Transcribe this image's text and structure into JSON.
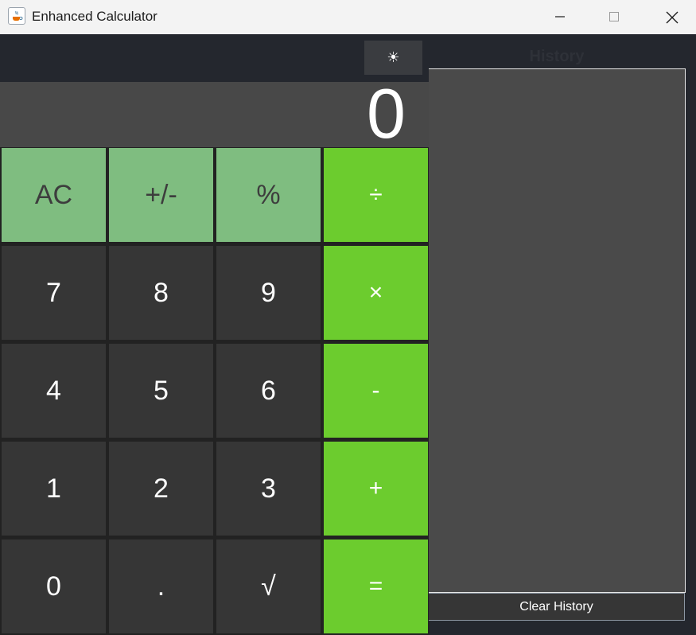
{
  "window": {
    "title": "Enhanced Calculator",
    "app_icon": "java-cup-icon",
    "controls": {
      "minimize": "minimize-icon",
      "maximize": "maximize-icon",
      "close": "close-icon"
    }
  },
  "toolbar": {
    "theme_toggle": "☀",
    "theme_icon": "sun-icon"
  },
  "display": {
    "value": "0"
  },
  "keypad": {
    "rows": [
      [
        {
          "label": "AC",
          "kind": "fn"
        },
        {
          "label": "+/-",
          "kind": "fn"
        },
        {
          "label": "%",
          "kind": "fn"
        },
        {
          "label": "÷",
          "kind": "op"
        }
      ],
      [
        {
          "label": "7",
          "kind": "num"
        },
        {
          "label": "8",
          "kind": "num"
        },
        {
          "label": "9",
          "kind": "num"
        },
        {
          "label": "×",
          "kind": "op"
        }
      ],
      [
        {
          "label": "4",
          "kind": "num"
        },
        {
          "label": "5",
          "kind": "num"
        },
        {
          "label": "6",
          "kind": "num"
        },
        {
          "label": "-",
          "kind": "op"
        }
      ],
      [
        {
          "label": "1",
          "kind": "num"
        },
        {
          "label": "2",
          "kind": "num"
        },
        {
          "label": "3",
          "kind": "num"
        },
        {
          "label": "+",
          "kind": "op"
        }
      ],
      [
        {
          "label": "0",
          "kind": "num"
        },
        {
          "label": ".",
          "kind": "num"
        },
        {
          "label": "√",
          "kind": "num"
        },
        {
          "label": "=",
          "kind": "op"
        }
      ]
    ]
  },
  "history": {
    "title": "History",
    "entries": [],
    "clear_label": "Clear History"
  },
  "colors": {
    "background": "#24272e",
    "display": "#484848",
    "number_key": "#363636",
    "function_key": "#7fbd80",
    "operator_key": "#6ccc2e",
    "history_panel": "#4a4a4a"
  }
}
